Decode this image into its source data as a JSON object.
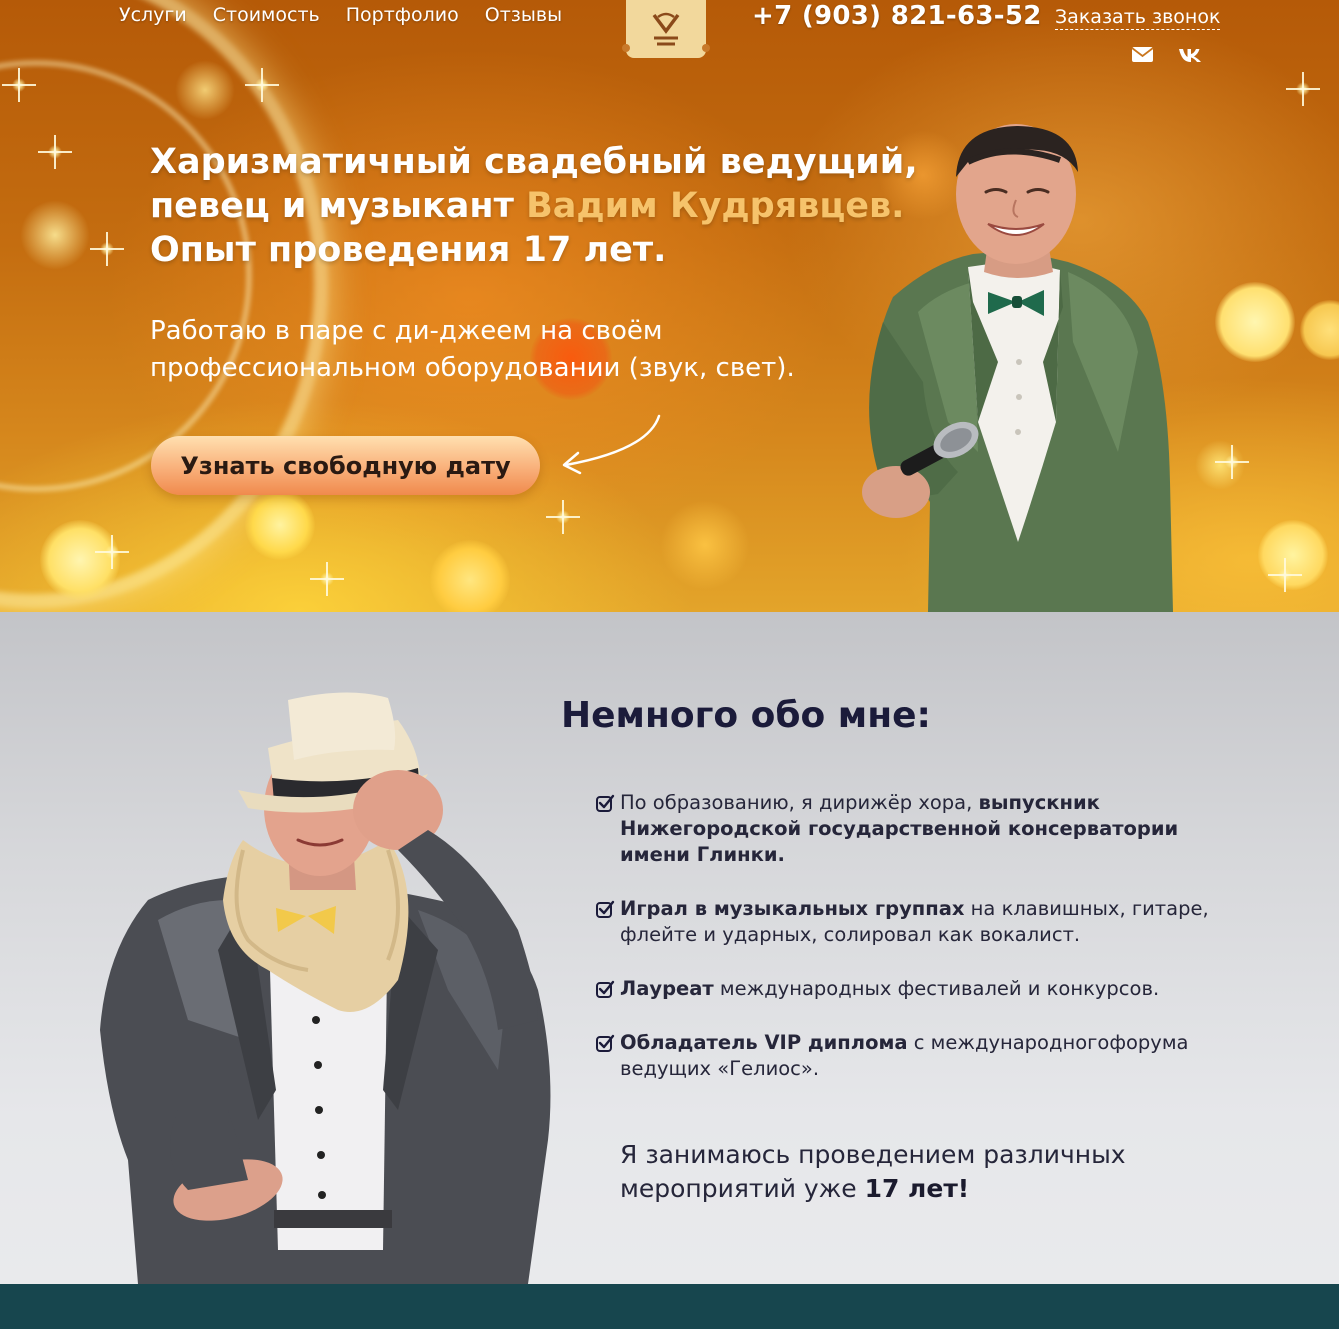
{
  "header": {
    "nav": [
      "Услуги",
      "Стоимость",
      "Портфолио",
      "Отзывы"
    ],
    "phone": "+7 (903) 821-63-52",
    "callback_label": "Заказать звонок",
    "social_icons": [
      "mail-icon",
      "vk-icon"
    ]
  },
  "hero": {
    "title_part1": "Харизматичный свадебный ведущий, певец и музыкант ",
    "title_name": "Вадим Кудрявцев.",
    "title_part2": "Опыт проведения 17 лет.",
    "subtitle": "Работаю в паре с ди-джеем на своём профессиональном оборудовании (звук, свет).",
    "cta_label": "Узнать свободную дату"
  },
  "about": {
    "title": "Немного обо мне:",
    "facts": [
      {
        "plain_before": "По образованию, я дирижёр хора, ",
        "bold": "выпускник Нижегородской государственной консерватории имени Глинки.",
        "plain_after": ""
      },
      {
        "plain_before": "",
        "bold": "Играл в музыкальных группах",
        "plain_after": " на клавишных, гитаре, флейте и ударных, солировал как вокалист."
      },
      {
        "plain_before": "",
        "bold": "Лауреат",
        "plain_after": " международных фестивалей и конкурсов."
      },
      {
        "plain_before": "",
        "bold": "Обладатель VIP диплома",
        "plain_after": " с международногофорума ведущих «Гелиос»."
      }
    ],
    "experience_plain": "Я занимаюсь проведением различных мероприятий уже ",
    "experience_bold": "17 лет!"
  },
  "colors": {
    "accent_gold": "#f6c36b",
    "cta_gradient_top": "#ffe0b0",
    "cta_gradient_bottom": "#f08a4d",
    "title_dark": "#1b1b3a",
    "footer_strip": "#17464e"
  }
}
